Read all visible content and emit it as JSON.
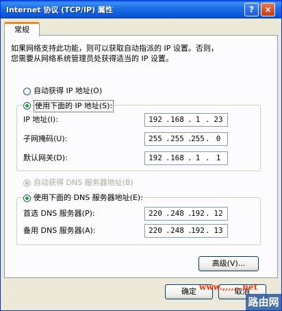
{
  "window": {
    "title": "Internet 协议 (TCP/IP) 属性",
    "help": "?",
    "close": "×"
  },
  "tab": {
    "label": "常规"
  },
  "description": [
    "如果网络支持此功能，则可以获取自动指派的 IP 设置。否则，",
    "您需要从网络系统管理员处获得适当的 IP 设置。"
  ],
  "ip_section": {
    "auto_label": "自动获得 IP 地址(O)",
    "manual_label": "使用下面的 IP 地址(S):",
    "fields": [
      {
        "label": "IP 地址(I):",
        "octets": [
          "192",
          "168",
          "1",
          "23"
        ]
      },
      {
        "label": "子网掩码(U):",
        "octets": [
          "255",
          "255",
          "255",
          "0"
        ]
      },
      {
        "label": "默认网关(D):",
        "octets": [
          "192",
          "168",
          "1",
          "1"
        ]
      }
    ]
  },
  "dns_section": {
    "auto_label": "自动获得 DNS 服务器地址(B)",
    "manual_label": "使用下面的 DNS 服务器地址(E):",
    "fields": [
      {
        "label": "首选 DNS 服务器(P):",
        "octets": [
          "220",
          "248",
          "192",
          "12"
        ]
      },
      {
        "label": "备用 DNS 服务器(A):",
        "octets": [
          "220",
          "248",
          "192",
          "13"
        ]
      }
    ]
  },
  "buttons": {
    "advanced": "高级(V)...",
    "ok": "确定",
    "cancel": "取消"
  },
  "watermark": {
    "url": "www.,,,,,,.net",
    "logo": "路由网"
  },
  "colors": {
    "titlebar": "#0a5de8",
    "accent_tab": "#e68b2c",
    "radio_on": "#21a121",
    "watermark": "#ff3300"
  }
}
